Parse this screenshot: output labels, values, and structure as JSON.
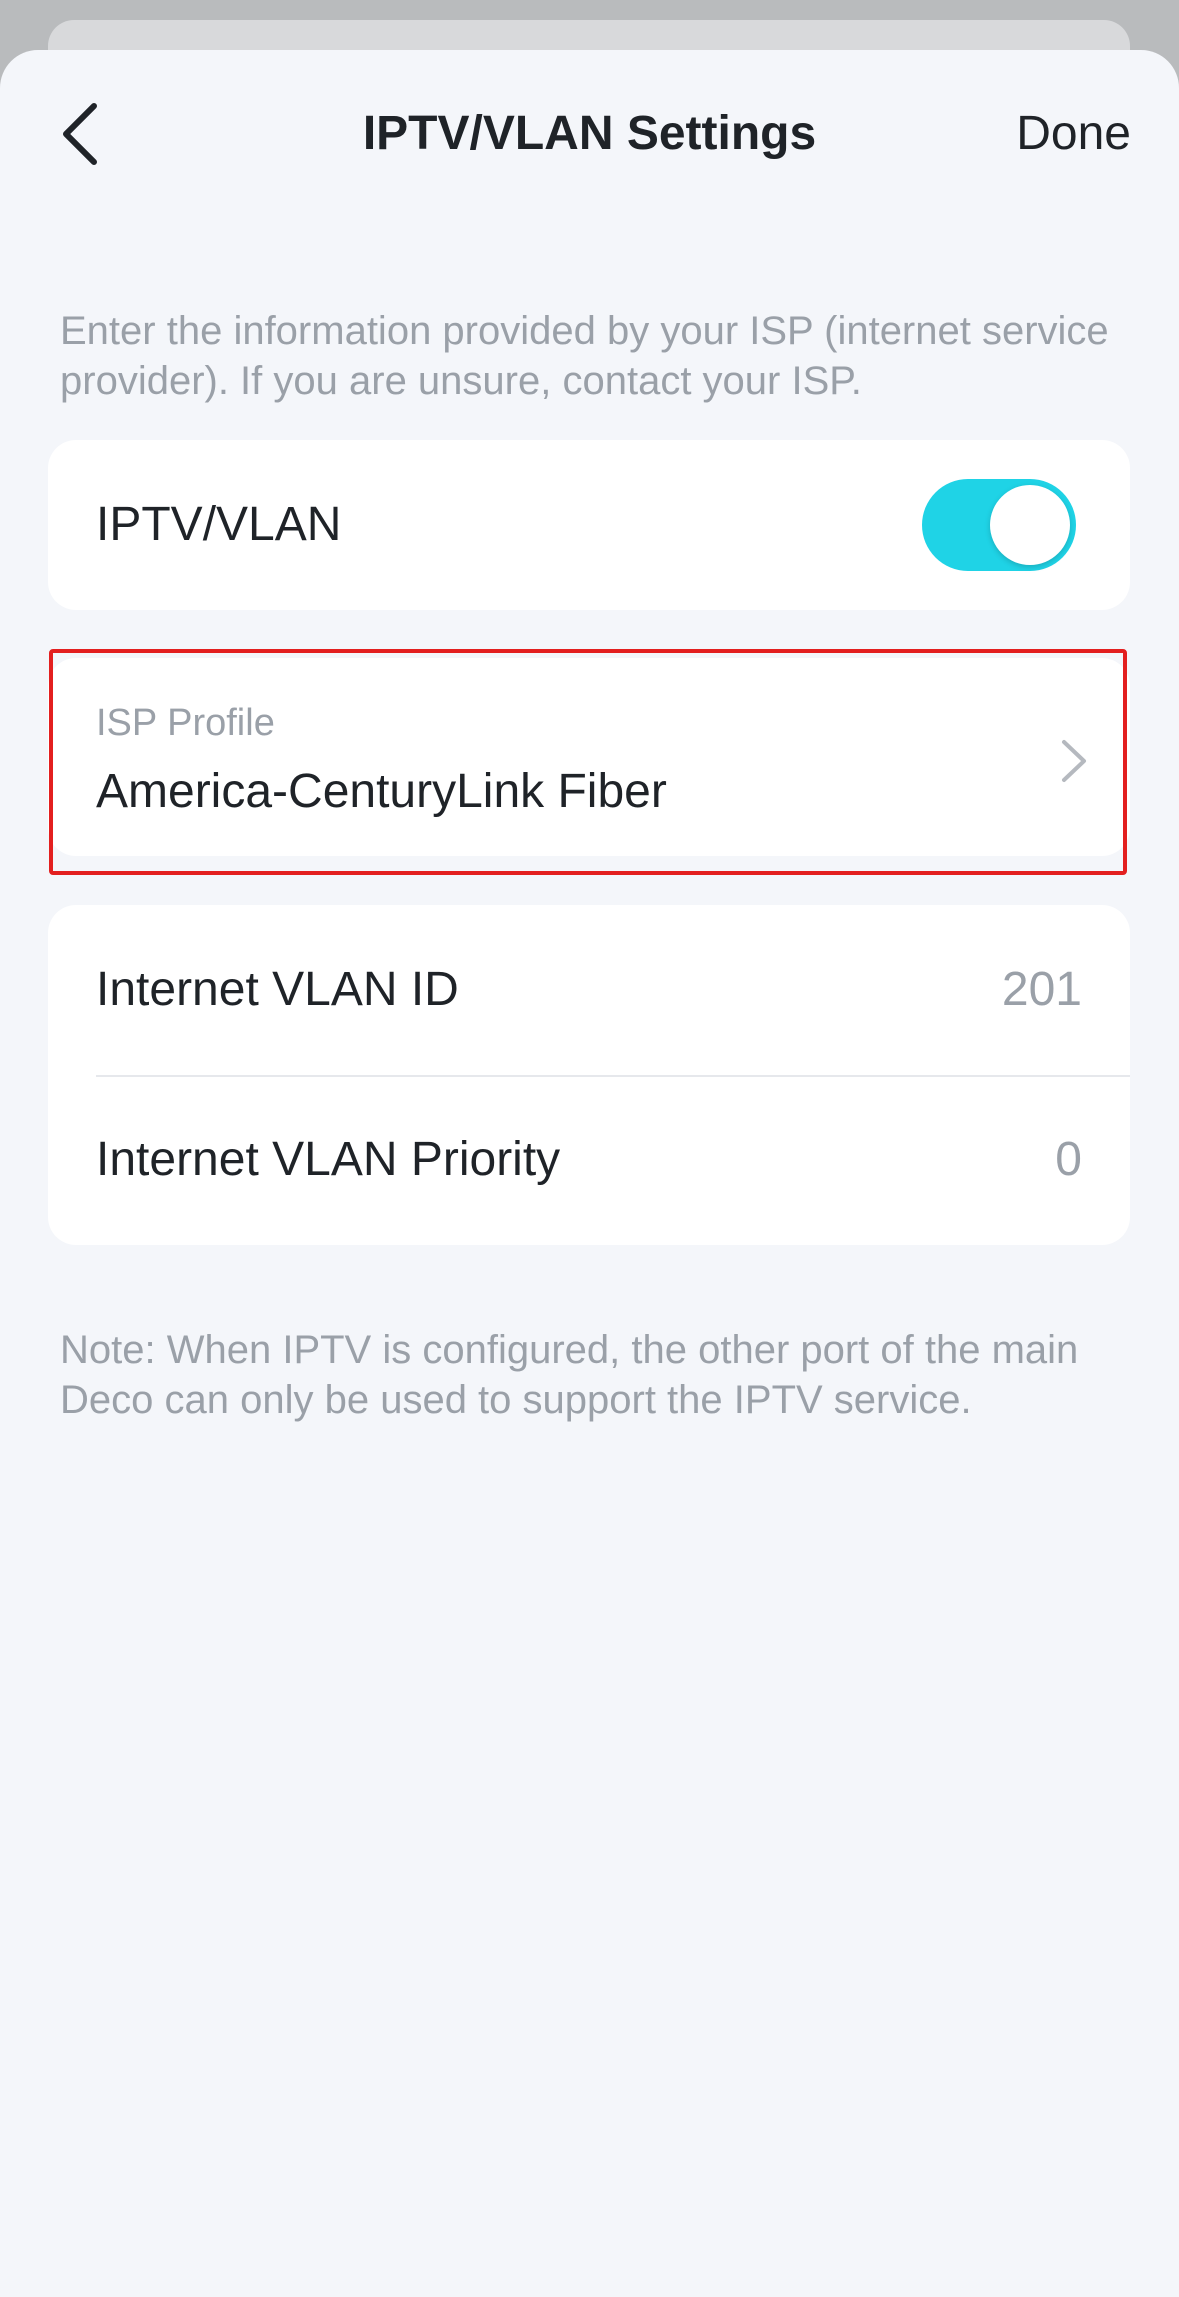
{
  "header": {
    "title": "IPTV/VLAN Settings",
    "done_label": "Done"
  },
  "intro_text": "Enter the information provided by your ISP (internet service provider). If you are unsure, contact your ISP.",
  "iptv_toggle": {
    "label": "IPTV/VLAN",
    "enabled": true,
    "color": "#1fd3e6"
  },
  "isp_profile": {
    "label": "ISP Profile",
    "value": "America-CenturyLink Fiber",
    "highlight_color": "#e31f1f"
  },
  "vlan": {
    "rows": [
      {
        "label": "Internet VLAN ID",
        "value": "201"
      },
      {
        "label": "Internet VLAN Priority",
        "value": "0"
      }
    ]
  },
  "note_text": "Note: When IPTV is configured, the other port of the main Deco can only be used to support the IPTV service.",
  "icons": {
    "back": "chevron-left-icon",
    "isp_chevron": "chevron-right-icon"
  }
}
